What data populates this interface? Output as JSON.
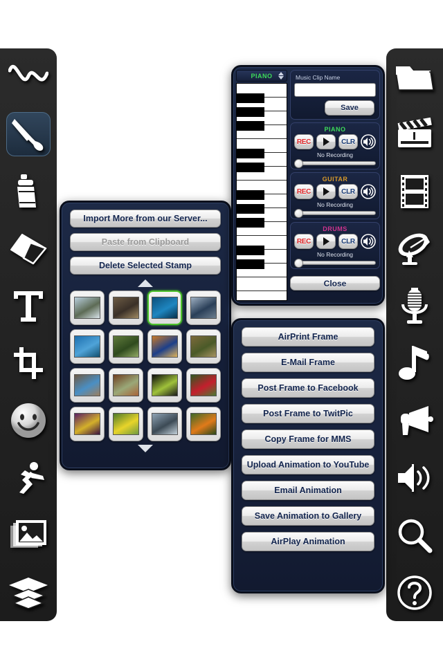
{
  "app": {
    "canvas_bg": "#ffffff",
    "panel_bg": "#16203a",
    "accent_selected": "#4cc22b"
  },
  "left_toolbar": {
    "items": [
      {
        "icon": "squiggle-line-icon",
        "label": "Line"
      },
      {
        "icon": "paintbrush-icon",
        "label": "Brush",
        "selected": true
      },
      {
        "icon": "spray-can-icon",
        "label": "Spray"
      },
      {
        "icon": "eraser-icon",
        "label": "Eraser"
      },
      {
        "icon": "text-tool-icon",
        "label": "Text"
      },
      {
        "icon": "crop-icon",
        "label": "Crop"
      },
      {
        "icon": "smiley-face-icon",
        "label": "Stamp"
      },
      {
        "icon": "running-figure-icon",
        "label": "Animate"
      },
      {
        "icon": "photo-image-icon",
        "label": "Image"
      },
      {
        "icon": "layers-icon",
        "label": "Layers"
      }
    ]
  },
  "right_toolbar": {
    "items": [
      {
        "icon": "folder-icon",
        "label": "Open"
      },
      {
        "icon": "clapperboard-icon",
        "label": "Movie"
      },
      {
        "icon": "film-strip-icon",
        "label": "Frames"
      },
      {
        "icon": "satellite-dish-icon",
        "label": "Broadcast"
      },
      {
        "icon": "microphone-icon",
        "label": "Record"
      },
      {
        "icon": "music-note-icon",
        "label": "Music"
      },
      {
        "icon": "megaphone-icon",
        "label": "Announce"
      },
      {
        "icon": "speaker-volume-icon",
        "label": "Volume"
      },
      {
        "icon": "magnifier-icon",
        "label": "Zoom"
      },
      {
        "icon": "help-question-icon",
        "label": "Help"
      }
    ]
  },
  "stamp_panel": {
    "actions": [
      {
        "label": "Import More from our Server...",
        "disabled": false
      },
      {
        "label": "Paste from Clipboard",
        "disabled": true
      },
      {
        "label": "Delete Selected Stamp",
        "disabled": false
      }
    ],
    "scroll_up_icon": "arrow-up-icon",
    "scroll_down_icon": "arrow-down-icon",
    "stamps": [
      {
        "name": "snowy-trees",
        "c1": "#b9cfdd",
        "c2": "#5d6b55",
        "c3": "#d9e4ea"
      },
      {
        "name": "armored-figure",
        "c1": "#6c5b44",
        "c2": "#3a3028",
        "c3": "#a08a63"
      },
      {
        "name": "underwater-diver",
        "c1": "#0d4f7a",
        "c2": "#1e86c0",
        "c3": "#06304c",
        "selected": true
      },
      {
        "name": "classic-car",
        "c1": "#9fb0c2",
        "c2": "#2a3f58",
        "c3": "#6d7f90"
      },
      {
        "name": "turtle-in-water",
        "c1": "#1d6fae",
        "c2": "#4fa3d8",
        "c3": "#12506f"
      },
      {
        "name": "green-forest",
        "c1": "#5f7a3c",
        "c2": "#2f4a1e",
        "c3": "#93ab66"
      },
      {
        "name": "colorful-bird",
        "c1": "#c87a2a",
        "c2": "#1c3f8a",
        "c3": "#e0b35a"
      },
      {
        "name": "woodland-path",
        "c1": "#7d6a3c",
        "c2": "#4a5a28",
        "c3": "#a89463"
      },
      {
        "name": "rock-formations",
        "c1": "#6d5a46",
        "c2": "#4a8fc4",
        "c3": "#9b7e5e"
      },
      {
        "name": "brown-horse",
        "c1": "#6f3f22",
        "c2": "#9aa878",
        "c3": "#a8643a"
      },
      {
        "name": "dark-insect",
        "c1": "#0c0c0c",
        "c2": "#9fc13a",
        "c3": "#1a1a1a"
      },
      {
        "name": "red-flower",
        "c1": "#2f5a22",
        "c2": "#c41f2d",
        "c3": "#4a7a33"
      },
      {
        "name": "purple-flower",
        "c1": "#5a1f63",
        "c2": "#d4b02a",
        "c3": "#3a1242"
      },
      {
        "name": "yellow-dandelion",
        "c1": "#4f7a2a",
        "c2": "#e8d42a",
        "c3": "#6f9a3f"
      },
      {
        "name": "stormy-sky",
        "c1": "#8fa3b4",
        "c2": "#3c4a55",
        "c3": "#c3d1da"
      },
      {
        "name": "orange-flower",
        "c1": "#3f6a2a",
        "c2": "#e07a1a",
        "c3": "#2a4a1c"
      }
    ]
  },
  "music_panel": {
    "keyboard": {
      "instrument": "PIANO",
      "instrument_color": "#3ddc5a",
      "stepper_icon": "stepper-updown-icon"
    },
    "clip": {
      "label": "Music Clip Name",
      "value": "",
      "save_label": "Save"
    },
    "tracks": [
      {
        "name": "PIANO",
        "color": "#3ddc5a",
        "rec_label": "REC",
        "play_icon": "play-icon",
        "clr_label": "CLR",
        "speaker_icon": "speaker-icon",
        "status": "No Recording",
        "slider_value": 0
      },
      {
        "name": "GUITAR",
        "color": "#d89a2a",
        "rec_label": "REC",
        "play_icon": "play-icon",
        "clr_label": "CLR",
        "speaker_icon": "speaker-icon",
        "status": "No Recording",
        "slider_value": 0
      },
      {
        "name": "DRUMS",
        "color": "#d0338f",
        "rec_label": "REC",
        "play_icon": "play-icon",
        "clr_label": "CLR",
        "speaker_icon": "speaker-icon",
        "status": "No Recording",
        "slider_value": 0
      }
    ],
    "close_label": "Close"
  },
  "share_panel": {
    "buttons": [
      {
        "label": "AirPrint Frame"
      },
      {
        "label": "E-Mail Frame"
      },
      {
        "label": "Post Frame to Facebook"
      },
      {
        "label": "Post Frame to TwitPic"
      },
      {
        "label": "Copy Frame for MMS"
      },
      {
        "label": "Upload Animation to YouTube"
      },
      {
        "label": "Email Animation"
      },
      {
        "label": "Save Animation to Gallery"
      },
      {
        "label": "AirPlay Animation"
      }
    ]
  }
}
